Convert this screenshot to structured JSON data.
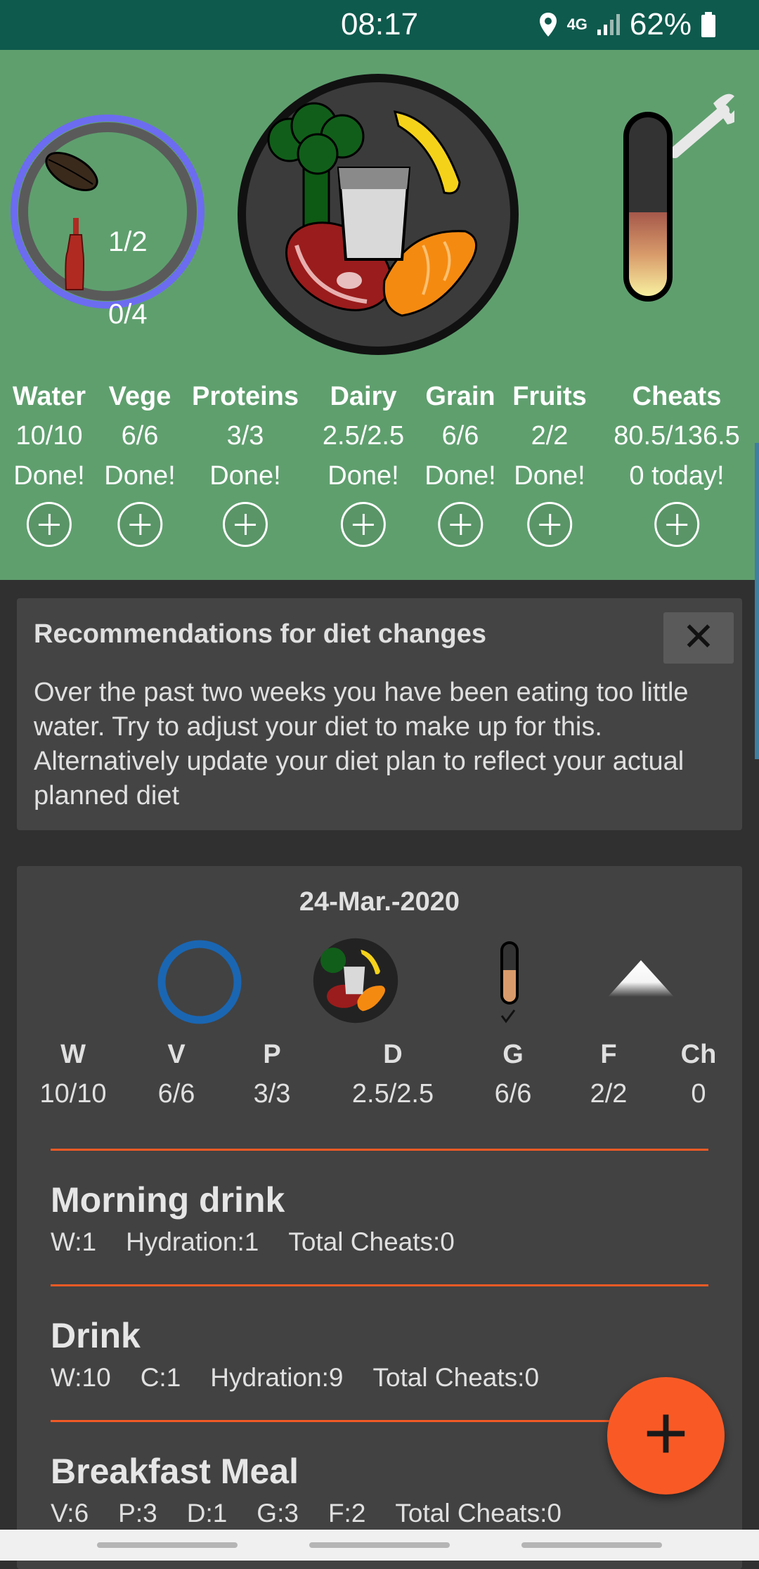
{
  "status_bar": {
    "time": "08:17",
    "network": "4G",
    "battery": "62%"
  },
  "summary": {
    "seeds_value": "1/2",
    "drinks_value": "0/4",
    "columns": [
      {
        "name": "Water",
        "value": "10/10",
        "status": "Done!"
      },
      {
        "name": "Vege",
        "value": "6/6",
        "status": "Done!"
      },
      {
        "name": "Proteins",
        "value": "3/3",
        "status": "Done!"
      },
      {
        "name": "Dairy",
        "value": "2.5/2.5",
        "status": "Done!"
      },
      {
        "name": "Grain",
        "value": "6/6",
        "status": "Done!"
      },
      {
        "name": "Fruits",
        "value": "2/2",
        "status": "Done!"
      },
      {
        "name": "Cheats",
        "value": "80.5/136.5",
        "status": "0 today!"
      }
    ]
  },
  "recommendation": {
    "title": "Recommendations for diet changes",
    "text": "Over the past two weeks you have been eating too little water. Try to adjust your diet to make up for this. Alternatively update your diet plan to reflect your actual planned diet",
    "close_label": "✕"
  },
  "day": {
    "date": "24-Mar.-2020",
    "columns": [
      {
        "name": "W",
        "value": "10/10"
      },
      {
        "name": "V",
        "value": "6/6"
      },
      {
        "name": "P",
        "value": "3/3"
      },
      {
        "name": "D",
        "value": "2.5/2.5"
      },
      {
        "name": "G",
        "value": "6/6"
      },
      {
        "name": "F",
        "value": "2/2"
      },
      {
        "name": "Ch",
        "value": "0"
      }
    ],
    "meals": [
      {
        "title": "Morning drink",
        "details": [
          "W:1",
          "Hydration:1",
          "Total Cheats:0"
        ]
      },
      {
        "title": "Drink",
        "details": [
          "W:10",
          "C:1",
          "Hydration:9",
          "Total Cheats:0"
        ]
      },
      {
        "title": "Breakfast Meal",
        "details": [
          "V:6",
          "P:3",
          "D:1",
          "G:3",
          "F:2",
          "Total Cheats:0"
        ]
      }
    ]
  },
  "fab_label": "+",
  "colors": {
    "header_green": "#5f9f6e",
    "accent": "#f95a25",
    "status_bar": "#0e5a4d"
  }
}
